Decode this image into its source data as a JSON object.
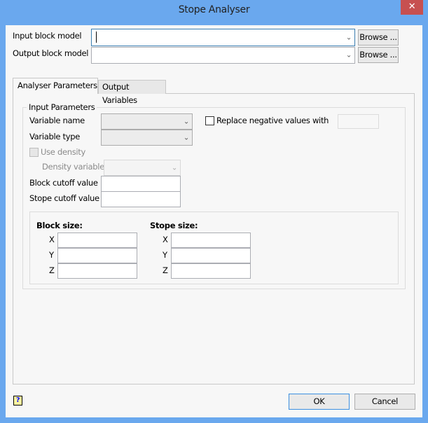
{
  "window": {
    "title": "Stope Analyser",
    "close_glyph": "✕"
  },
  "input_block_model": {
    "label": "Input block model",
    "value": "",
    "browse": "Browse ..."
  },
  "output_block_model": {
    "label": "Output block model",
    "value": "",
    "browse": "Browse ..."
  },
  "tabs": [
    {
      "label": "Analyser Parameters",
      "active": true
    },
    {
      "label": "Output Variables",
      "active": false
    }
  ],
  "input_parameters": {
    "title": "Input Parameters",
    "variable_name_label": "Variable name",
    "variable_type_label": "Variable type",
    "replace_negative_label": "Replace negative values with",
    "replace_negative_checked": false,
    "use_density_label": "Use density",
    "density_variable_label": "Density variable",
    "block_cutoff_label": "Block cutoff value",
    "stope_cutoff_label": "Stope cutoff value"
  },
  "block_size": {
    "title": "Block size:",
    "x": "X",
    "y": "Y",
    "z": "Z"
  },
  "stope_size": {
    "title": "Stope size:",
    "x": "X",
    "y": "Y",
    "z": "Z"
  },
  "footer": {
    "ok": "OK",
    "cancel": "Cancel",
    "help_glyph": "?"
  },
  "chevron": "⌄"
}
